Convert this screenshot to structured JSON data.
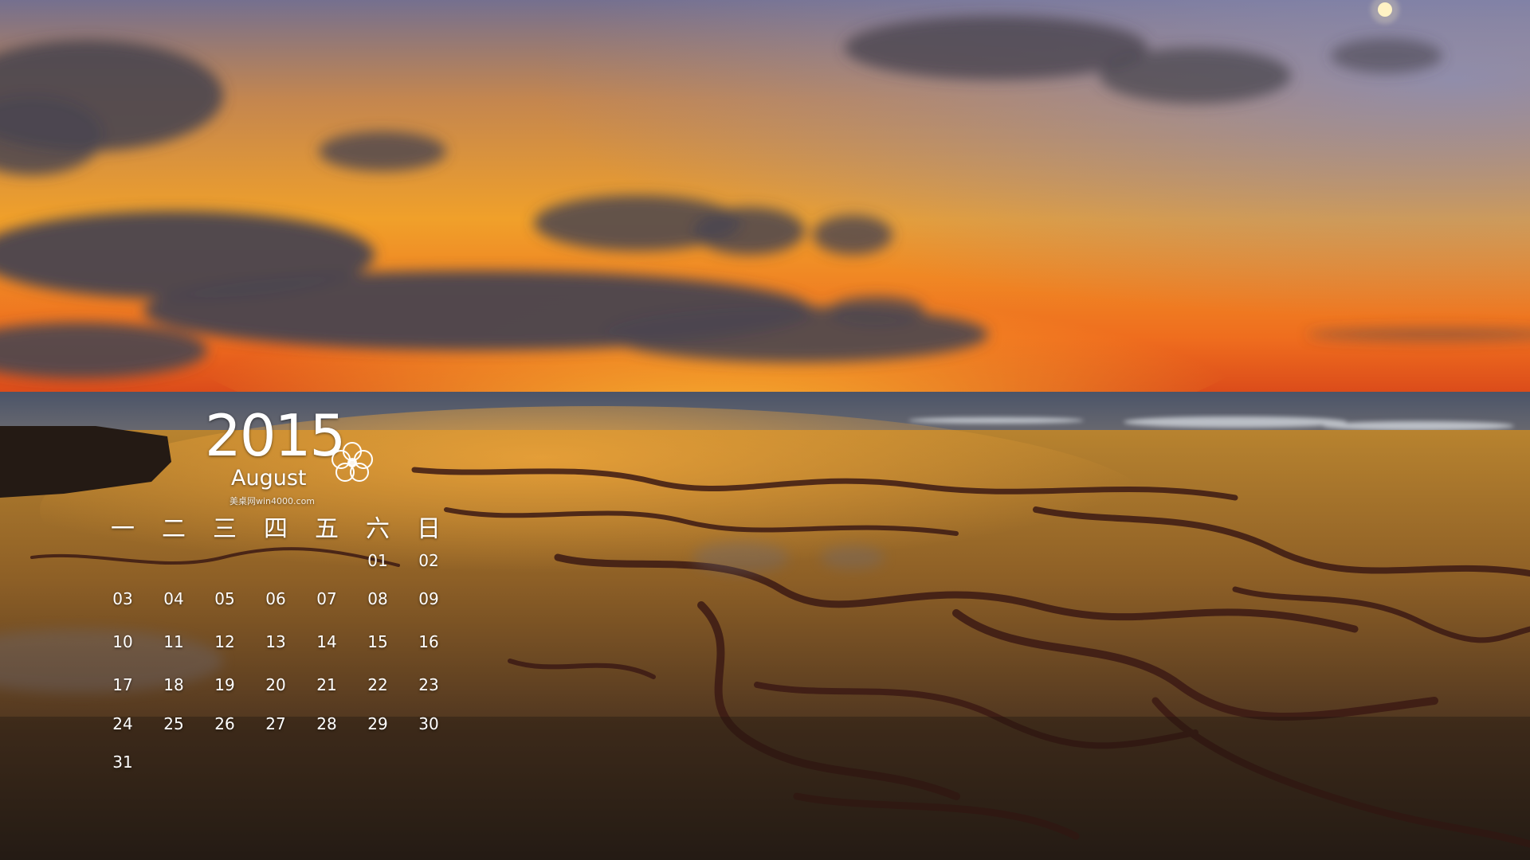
{
  "calendar": {
    "year": "2015",
    "month": "August",
    "watermark": "美桌网win4000.com",
    "weekdays": [
      "一",
      "二",
      "三",
      "四",
      "五",
      "六",
      "日"
    ],
    "weeks": [
      [
        "",
        "",
        "",
        "",
        "",
        "01",
        "02"
      ],
      [
        "03",
        "04",
        "05",
        "06",
        "07",
        "08",
        "09"
      ],
      [
        "10",
        "11",
        "12",
        "13",
        "14",
        "15",
        "16"
      ],
      [
        "17",
        "18",
        "19",
        "20",
        "21",
        "22",
        "23"
      ],
      [
        "24",
        "25",
        "26",
        "27",
        "28",
        "29",
        "30"
      ],
      [
        "31",
        "",
        "",
        "",
        "",
        "",
        ""
      ]
    ]
  },
  "scene": {
    "subject": "sunset-over-tidal-flats",
    "colors": {
      "sky_top": "#6f6a8f",
      "sky_glow": "#f29a1f",
      "horizon": "#e8541c",
      "sea": "#5c6474",
      "flat_light": "#c9892c",
      "flat_dark": "#2a1f18",
      "seaweed": "#3c1a14",
      "cloud": "#4a4550"
    }
  }
}
